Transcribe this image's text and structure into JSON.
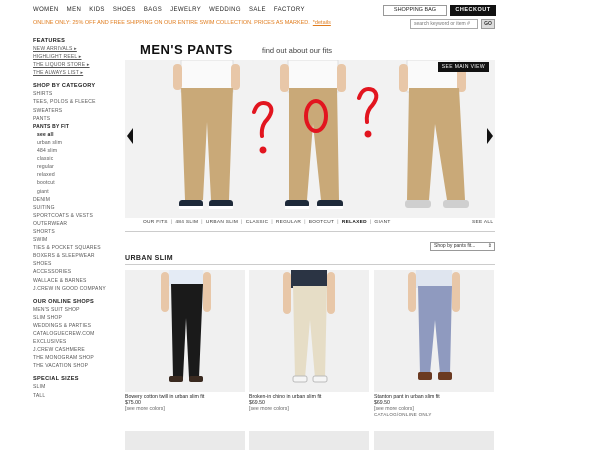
{
  "topnav": [
    "WOMEN",
    "MEN",
    "KIDS",
    "SHOES",
    "BAGS",
    "JEWELRY",
    "WEDDING",
    "SALE",
    "FACTORY"
  ],
  "header": {
    "shopping_bag": "SHOPPING BAG",
    "checkout": "CHECKOUT",
    "promo": "ONLINE ONLY: 25% OFF AND FREE SHIPPING ON OUR ENTIRE SWIM COLLECTION. PRICES AS MARKED.",
    "promo_link": "*details",
    "search_placeholder": "search keyword or item #",
    "go": "GO"
  },
  "sidebar": {
    "features_title": "FEATURES",
    "features": [
      "NEW ARRIVALS ▸",
      "HIGHLIGHT REEL ▸",
      "THE LIQUOR STORE ▸",
      "THE ALWAYS LIST ▸"
    ],
    "category_title": "SHOP BY CATEGORY",
    "categories_a": [
      "SHIRTS",
      "TEES, POLOS & FLEECE",
      "SWEATERS",
      "PANTS"
    ],
    "pants_by_fit": "PANTS BY FIT",
    "fit_selected": "see all",
    "fits": [
      "urban slim",
      "484 slim",
      "classic",
      "regular",
      "relaxed",
      "bootcut",
      "giant"
    ],
    "categories_b": [
      "DENIM",
      "SUITING",
      "SPORTCOATS & VESTS",
      "OUTERWEAR",
      "SHORTS",
      "SWIM",
      "TIES & POCKET SQUARES",
      "BOXERS & SLEEPWEAR",
      "SHOES",
      "ACCESSORIES",
      "WALLACE & BARNES",
      "J.CREW IN GOOD COMPANY"
    ],
    "online_title": "OUR ONLINE SHOPS",
    "online": [
      "MEN'S SUIT SHOP",
      "SLIM SHOP",
      "WEDDINGS & PARTIES",
      "CATALOGUECREW.COM EXCLUSIVES",
      "J.CREW CASHMERE",
      "THE MONOGRAM SHOP",
      "THE VACATION SHOP"
    ],
    "sizes_title": "SPECIAL SIZES",
    "sizes": [
      "SLIM",
      "TALL"
    ]
  },
  "hero": {
    "title": "MEN'S PANTS",
    "subtitle": "find out about our fits",
    "see_main_view": "SEE MAIN VIEW",
    "fits_bar": [
      "OUR FITS",
      "484 SLIM",
      "URBAN SLIM",
      "CLASSIC",
      "REGULAR",
      "BOOTCUT",
      "RELAXED",
      "GIANT"
    ],
    "see_all": "SEE ALL"
  },
  "sort": {
    "label": "Shop by pants fit...",
    "chevron": "⇕"
  },
  "section_title": "URBAN SLIM",
  "products": [
    {
      "name": "Bowery cotton twill in urban slim fit",
      "price": "$75.00",
      "more": "[see more colors]",
      "note": ""
    },
    {
      "name": "Broken-in chino in urban slim fit",
      "price": "$69.50",
      "more": "[see more colors]",
      "note": ""
    },
    {
      "name": "Stanton pant in urban slim fit",
      "price": "$69.50",
      "more": "[see more colors]",
      "note": "CATALOG/ONLINE ONLY"
    }
  ],
  "colors": {
    "promo": "#e07c1d",
    "annotation_red": "#e2151f",
    "khaki": "#c9a978",
    "brand_dark": "#111111"
  }
}
